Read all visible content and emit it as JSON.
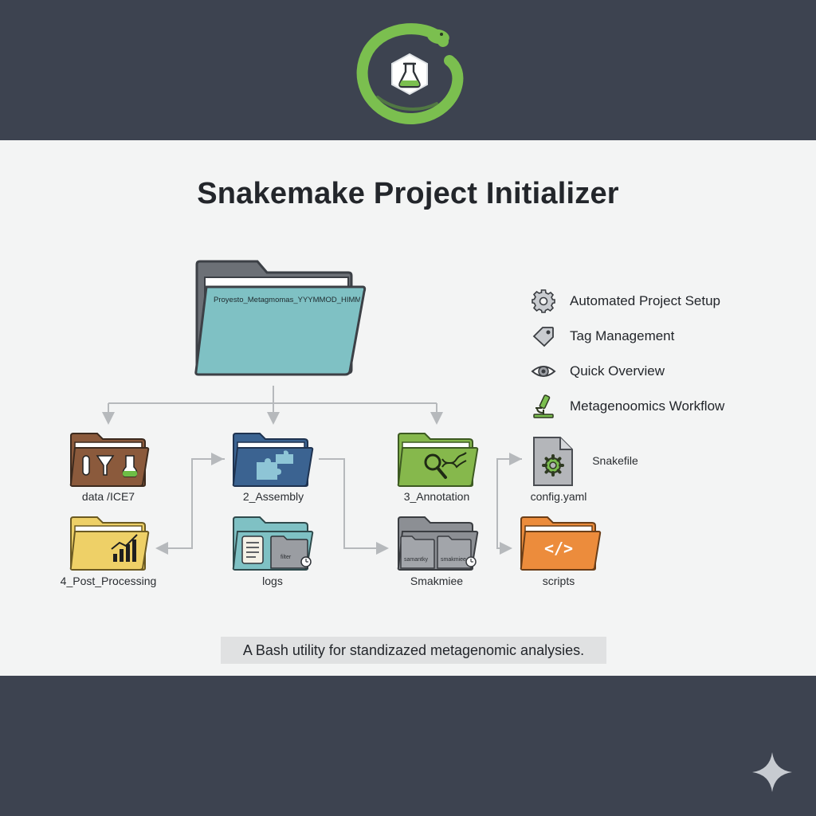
{
  "title": "Snakemake Project Initializer",
  "root_folder": {
    "label": "Proyesto_Metagmomas_YYYMMOD_HIMMSS/"
  },
  "folders": [
    {
      "label": "data /ICE7",
      "icon": "lab-equipment-icon"
    },
    {
      "label": "2_Assembly",
      "icon": "puzzle-icon"
    },
    {
      "label": "3_Annotation",
      "icon": "magnifier-dna-icon"
    },
    {
      "label": "4_Post_Processing",
      "icon": "bar-chart-icon"
    },
    {
      "label": "logs",
      "icon": "scroll-icon",
      "inner_label": "filter"
    },
    {
      "label": "Smakmiee",
      "icon": "stacked-folders-icon",
      "inner_labels": [
        "samantky",
        "smakmiee"
      ]
    }
  ],
  "files": [
    {
      "label": "Snakefile",
      "icon": "gear-file-icon"
    },
    {
      "label": "config.yaml"
    },
    {
      "label": "scripts",
      "icon": "code-icon",
      "glyph": "</>"
    }
  ],
  "features": [
    {
      "label": "Automated Project Setup",
      "icon": "gear-icon"
    },
    {
      "label": "Tag Management",
      "icon": "tag-icon"
    },
    {
      "label": "Quick Overview",
      "icon": "eye-icon"
    },
    {
      "label": "Metagenoomics Workflow",
      "icon": "microscope-icon"
    }
  ],
  "caption": "A Bash utility for standizazed metagenomic analysies.",
  "colors": {
    "band": "#3d4350",
    "panel": "#f3f4f4",
    "snake_green": "#7bbf4f",
    "teal": "#7fc1c4",
    "brown": "#8b5a3c",
    "blue": "#3b6391",
    "green_folder": "#86b84c",
    "yellow": "#eed067",
    "gray": "#8c8f94",
    "orange": "#ec8c3c"
  }
}
